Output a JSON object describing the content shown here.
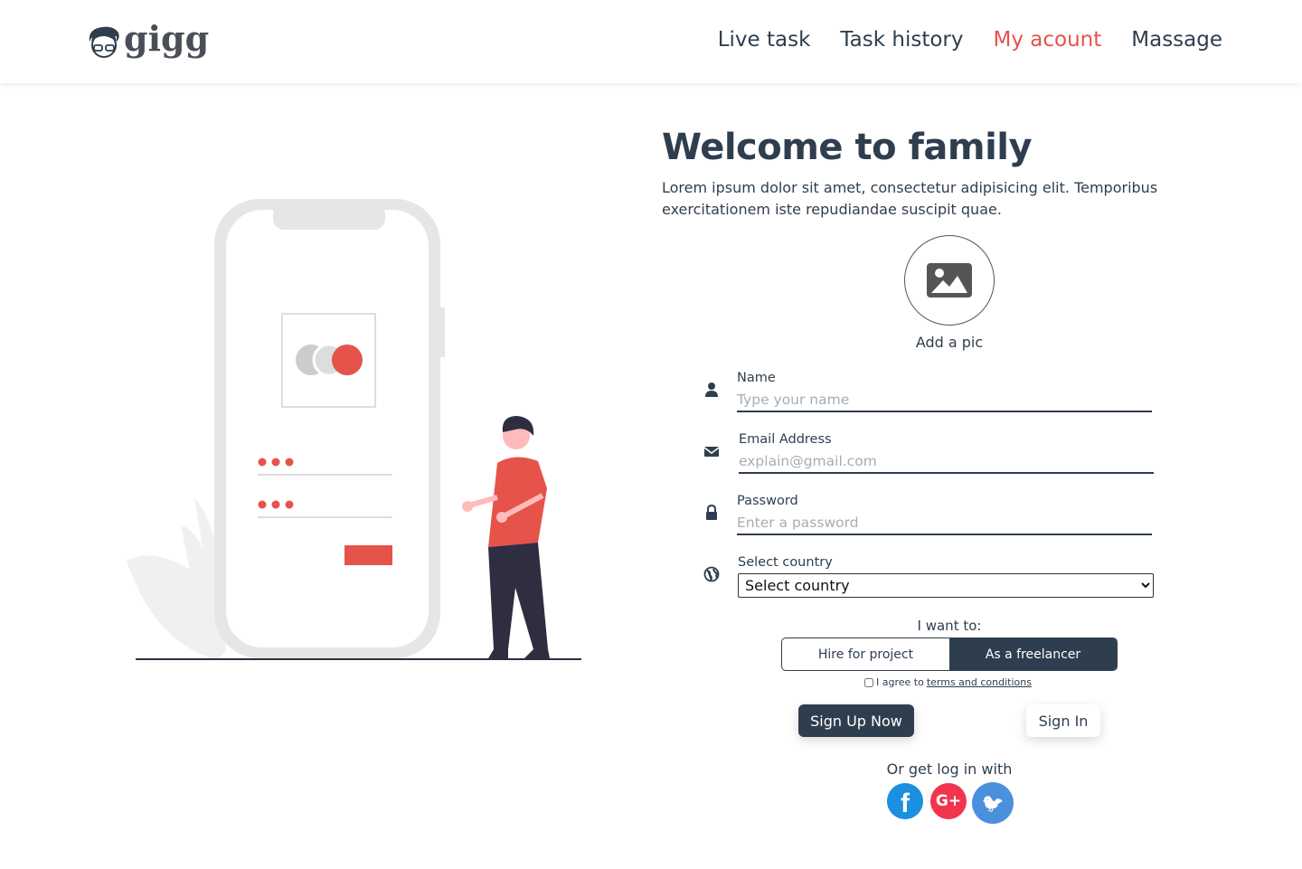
{
  "brand": {
    "name": "gigg"
  },
  "nav": {
    "items": [
      {
        "label": "Live task"
      },
      {
        "label": "Task history"
      },
      {
        "label": "My acount"
      },
      {
        "label": "Massage"
      }
    ],
    "active_color": "#e5534b"
  },
  "hero": {
    "title": "Welcome to family",
    "description": "Lorem ipsum dolor sit amet, consectetur adipisicing elit. Temporibus exercitationem iste repudiandae suscipit quae."
  },
  "avatar": {
    "label": "Add a pic"
  },
  "form": {
    "name": {
      "label": "Name",
      "placeholder": "Type your name",
      "value": ""
    },
    "email": {
      "label": "Email Address",
      "placeholder": "explain@gmail.com",
      "value": ""
    },
    "password": {
      "label": "Password",
      "placeholder": "Enter a password",
      "value": ""
    },
    "country": {
      "label": "Select country",
      "selected": "Select country"
    },
    "want_label": "I want to:",
    "roles": [
      {
        "label": "Hire for project",
        "selected": false
      },
      {
        "label": "As a freelancer",
        "selected": true
      }
    ],
    "agree_text": "I agree to",
    "terms_link": "terms and conditions",
    "signup_label": "Sign Up Now",
    "signin_label": "Sign In",
    "social_label": "Or get log in with",
    "social": [
      {
        "name": "facebook",
        "glyph": "f",
        "color": "#1b8fe0"
      },
      {
        "name": "google-plus",
        "glyph": "G+",
        "color": "#f2344e"
      },
      {
        "name": "twitter",
        "glyph": "🐦",
        "color": "#4b90dd"
      }
    ]
  },
  "colors": {
    "primary": "#2f3e4f",
    "accent": "#e5534b"
  }
}
